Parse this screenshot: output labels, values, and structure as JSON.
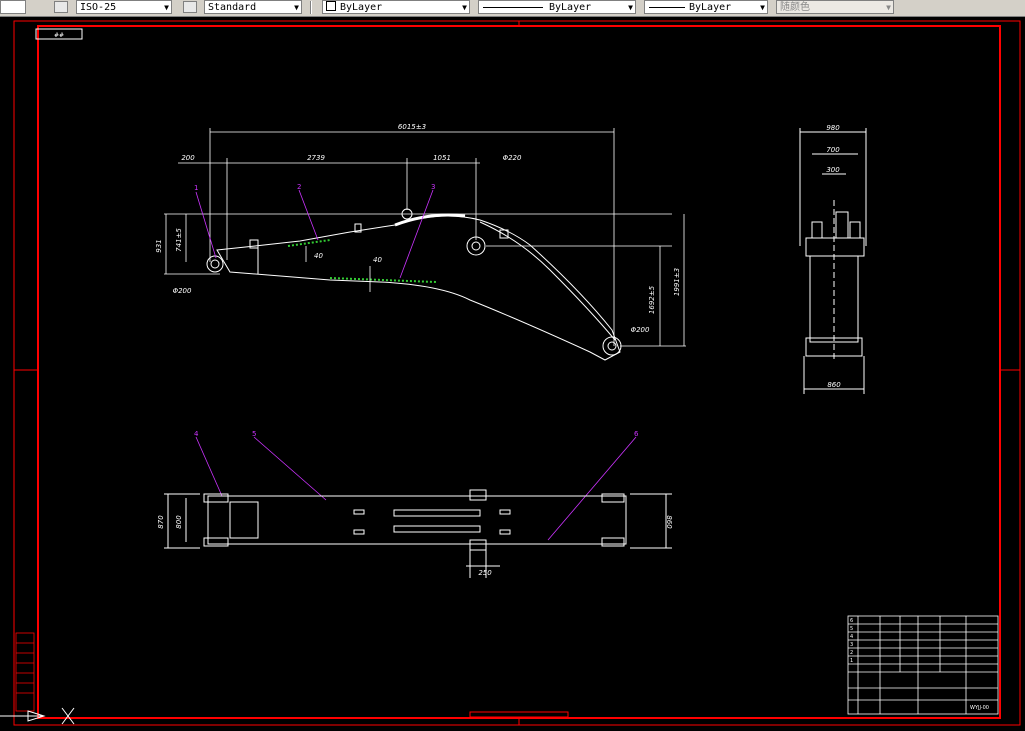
{
  "toolbar": {
    "dimstyle": "ISO-25",
    "textstyle": "Standard",
    "color": "ByLayer",
    "linetype": "ByLayer",
    "lineweight": "ByLayer",
    "plotstyle": "随颜色"
  },
  "drawing": {
    "title_tag": "##",
    "dims": {
      "total_len": "6015±3",
      "d200": "200",
      "d2739": "2739",
      "d1051": "1051",
      "phi220": "Φ220",
      "h931": "931",
      "h741": "741±5",
      "h40a": "40",
      "h40b": "40",
      "phi200a": "Φ200",
      "phi200b": "Φ200",
      "h1692": "1692±5",
      "h1991": "1991±3",
      "w980": "980",
      "w700": "700",
      "w300": "300",
      "w860": "860",
      "v870": "870",
      "v800": "800",
      "v860": "860",
      "w250": "250"
    },
    "callouts": [
      "1",
      "2",
      "3",
      "4",
      "5",
      "6"
    ],
    "title_block": {
      "items": [
        "6",
        "5",
        "4",
        "3",
        "2",
        "1"
      ],
      "sheet": "WYJJ-00"
    }
  },
  "colors": {
    "border": "#ff0000",
    "geometry": "#ffffff",
    "dims": "#ffffff",
    "callouts": "#cc33ff",
    "weld": "#33cc33"
  }
}
